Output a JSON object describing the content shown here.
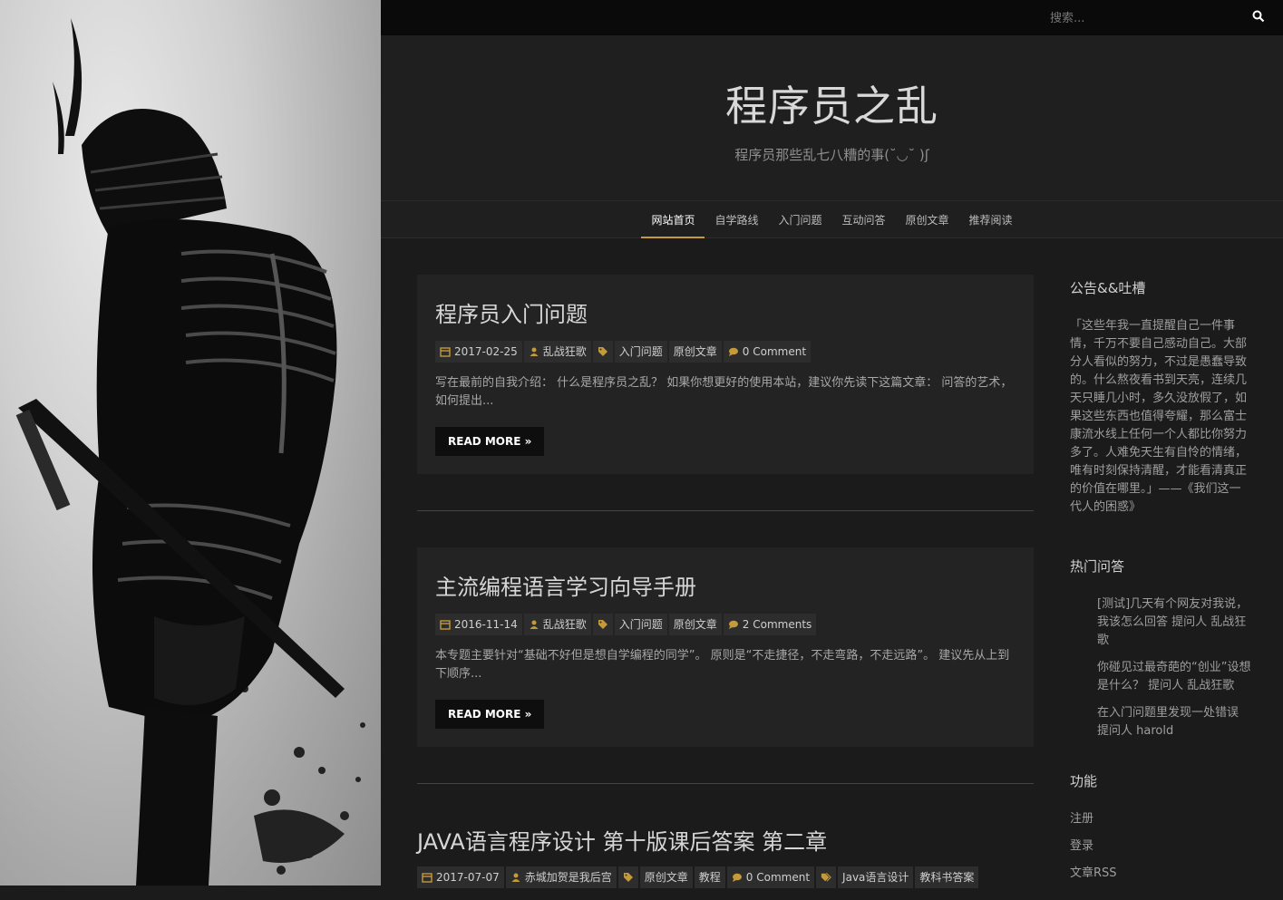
{
  "search": {
    "placeholder": "搜索..."
  },
  "site": {
    "title": "程序员之乱",
    "subtitle": "程序员那些乱七八糟的事(˘◡˘ )ʃ"
  },
  "nav": {
    "items": [
      {
        "label": "网站首页",
        "active": true
      },
      {
        "label": "自学路线",
        "active": false
      },
      {
        "label": "入门问题",
        "active": false
      },
      {
        "label": "互动问答",
        "active": false
      },
      {
        "label": "原创文章",
        "active": false
      },
      {
        "label": "推荐阅读",
        "active": false
      }
    ]
  },
  "posts": [
    {
      "title": "程序员入门问题",
      "date": "2017-02-25",
      "author": "乱战狂歌",
      "tags": [
        "入门问题",
        "原创文章"
      ],
      "comments": "0 Comment",
      "excerpt": "写在最前的自我介绍： 什么是程序员之乱？ 如果你想更好的使用本站，建议你先读下这篇文章： 问答的艺术，如何提出...",
      "read_more": "READ MORE »"
    },
    {
      "title": "主流编程语言学习向导手册",
      "date": "2016-11-14",
      "author": "乱战狂歌",
      "tags": [
        "入门问题",
        "原创文章"
      ],
      "comments": "2 Comments",
      "excerpt": "本专题主要针对“基础不好但是想自学编程的同学”。 原则是“不走捷径，不走弯路，不走远路”。 建议先从上到下顺序...",
      "read_more": "READ MORE »"
    },
    {
      "title": "JAVA语言程序设计 第十版课后答案 第二章",
      "date": "2017-07-07",
      "author": "赤城加贺是我后宫",
      "tags": [
        "原创文章",
        "教程"
      ],
      "comments": "0 Comment",
      "tags2": [
        "Java语言设计",
        "教科书答案"
      ]
    }
  ],
  "sidebar": {
    "notice_title": "公告&&吐槽",
    "notice_text": "「这些年我一直提醒自己一件事情，千万不要自己感动自己。大部分人看似的努力，不过是愚蠢导致的。什么熬夜看书到天亮，连续几天只睡几小时，多久没放假了，如果这些东西也值得夸耀，那么富士康流水线上任何一个人都比你努力多了。人难免天生有自怜的情绪，唯有时刻保持清醒，才能看清真正的价值在哪里。」——《我们这一代人的困惑》",
    "qa_title": "热门问答",
    "qa_items": [
      "[测试]几天有个网友对我说，我该怎么回答 提问人 乱战狂歌",
      "你碰见过最奇葩的“创业”设想是什么？ 提问人 乱战狂歌",
      "在入门问题里发现一处错误 提问人 harold"
    ],
    "func_title": "功能",
    "func_items": [
      "注册",
      "登录",
      "文章RSS"
    ]
  },
  "colors": {
    "accent": "#c49a3a",
    "background": "#1b1b1b",
    "card": "#232323",
    "topbar": "#0a0a0a"
  },
  "icons": {
    "date": "calendar-icon",
    "author": "user-icon",
    "tag": "tag-icon",
    "comment": "comment-icon",
    "search": "search-icon"
  }
}
